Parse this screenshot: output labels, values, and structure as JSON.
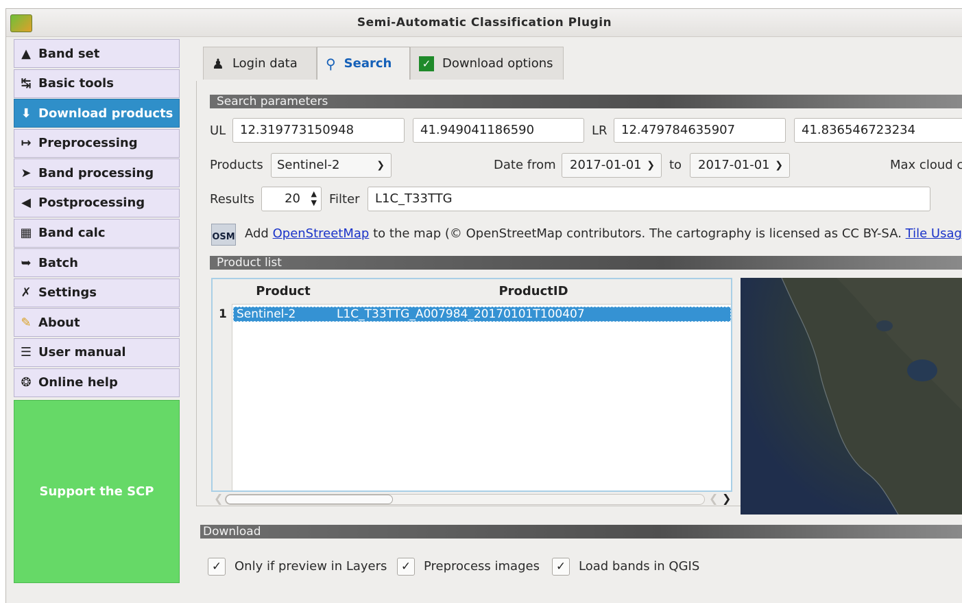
{
  "window": {
    "title": "Semi-Automatic Classification Plugin"
  },
  "menu": {
    "items": [
      {
        "label": "Band set",
        "icon": "band-set-icon"
      },
      {
        "label": "Basic tools",
        "icon": "basic-tools-icon"
      },
      {
        "label": "Download products",
        "icon": "download-icon",
        "active": true
      },
      {
        "label": "Preprocessing",
        "icon": "preprocessing-icon"
      },
      {
        "label": "Band processing",
        "icon": "band-processing-icon"
      },
      {
        "label": "Postprocessing",
        "icon": "postprocessing-icon"
      },
      {
        "label": "Band calc",
        "icon": "calculator-icon"
      },
      {
        "label": "Batch",
        "icon": "batch-icon"
      },
      {
        "label": "Settings",
        "icon": "settings-icon"
      },
      {
        "label": "About",
        "icon": "about-icon"
      },
      {
        "label": "User manual",
        "icon": "manual-icon"
      },
      {
        "label": "Online help",
        "icon": "help-icon"
      }
    ],
    "support_label": "Support the SCP"
  },
  "tabs": [
    {
      "label": "Login data",
      "icon": "user-icon"
    },
    {
      "label": "Search",
      "icon": "search-icon",
      "active": true
    },
    {
      "label": "Download options",
      "icon": "checkbox-icon"
    }
  ],
  "search": {
    "section_title": "Search parameters",
    "ul_label": "UL",
    "ul_x": "12.319773150948",
    "ul_y": "41.949041186590",
    "lr_label": "LR",
    "lr_x": "12.479784635907",
    "lr_y": "41.836546723234",
    "products_label": "Products",
    "products_value": "Sentinel-2",
    "date_from_label": "Date from",
    "date_from": "2017-01-01",
    "to_label": "to",
    "date_to": "2017-01-01",
    "max_cloud_label": "Max cloud c",
    "results_label": "Results",
    "results_value": "20",
    "filter_label": "Filter",
    "filter_value": "L1C_T33TTG"
  },
  "osm": {
    "badge": "OSM",
    "add_text": "Add",
    "link_text": "OpenStreetMap",
    "middle_text": "to the map  (© OpenStreetMap contributors. The cartography is licensed as CC BY-SA.",
    "tile_link": "Tile Usage P"
  },
  "product_list": {
    "section_title": "Product list",
    "columns": [
      "Product",
      "ProductID"
    ],
    "rows": [
      {
        "num": "1",
        "product": "Sentinel-2",
        "product_id": "L1C_T33TTG_A007984_20170101T100407"
      }
    ]
  },
  "download": {
    "section_title": "Download",
    "options": [
      {
        "label": "Only if preview in Layers",
        "checked": true
      },
      {
        "label": "Preprocess images",
        "checked": true
      },
      {
        "label": "Load bands in QGIS",
        "checked": true
      }
    ]
  }
}
